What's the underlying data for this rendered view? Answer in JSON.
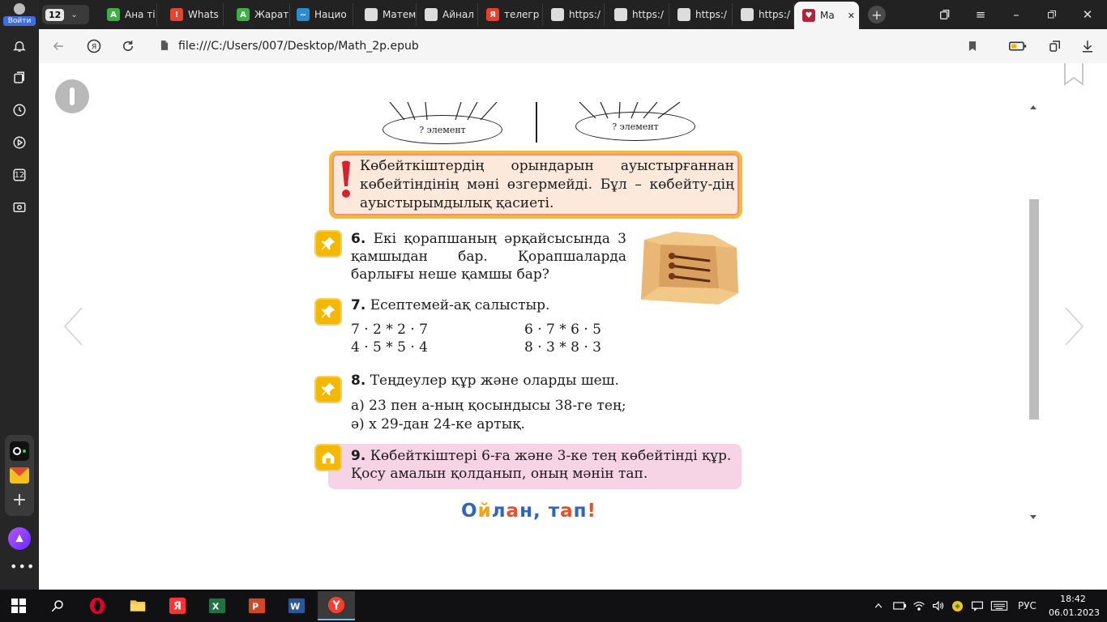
{
  "side_panel": {
    "login_label": "Войти",
    "items": [
      {
        "icon": "bell-icon"
      },
      {
        "icon": "collections-icon"
      },
      {
        "icon": "history-icon"
      },
      {
        "icon": "play-icon"
      },
      {
        "icon": "tab-counter-icon",
        "label": "12"
      },
      {
        "icon": "screenshot-icon"
      }
    ],
    "bottom": [
      {
        "icon": "alice-icon"
      },
      {
        "icon": "more-icon"
      }
    ]
  },
  "tabs": {
    "count": "12",
    "items": [
      {
        "label": "Ана ті",
        "favicon_color": "#3cb043",
        "favicon_glyph": "A"
      },
      {
        "label": "Whats",
        "favicon_color": "#e8432d",
        "favicon_glyph": "!"
      },
      {
        "label": "Жарат",
        "favicon_color": "#3cb043",
        "favicon_glyph": "A"
      },
      {
        "label": "Нацио",
        "favicon_color": "#2a8dd4",
        "favicon_glyph": "~"
      },
      {
        "label": "Матем",
        "favicon_color": "#dddddd",
        "favicon_glyph": ""
      },
      {
        "label": "Айнал",
        "favicon_color": "#dddddd",
        "favicon_glyph": ""
      },
      {
        "label": "телегр",
        "favicon_color": "#f23b2b",
        "favicon_glyph": "Я"
      },
      {
        "label": "https:/",
        "favicon_color": "#dddddd",
        "favicon_glyph": ""
      },
      {
        "label": "https:/",
        "favicon_color": "#dddddd",
        "favicon_glyph": ""
      },
      {
        "label": "https:/",
        "favicon_color": "#dddddd",
        "favicon_glyph": ""
      },
      {
        "label": "https:/",
        "favicon_color": "#dddddd",
        "favicon_glyph": ""
      },
      {
        "label": "Ma",
        "favicon_color": "#b3233a",
        "favicon_glyph": "♥",
        "active": true
      }
    ]
  },
  "address_bar": {
    "url": "file:///C:/Users/007/Desktop/Math_2p.epub"
  },
  "page": {
    "ellipse_left": "? элемент",
    "ellipse_right": "? элемент",
    "rule_text": "Көбейткіштердің орындарын ауыстырғаннан көбейтіндінің мәні өзгермейді. Бұл – көбейту-дің ауыстырымдылық қасиеті.",
    "task6": {
      "number": "6.",
      "text": "Екі қорапшаның әрқайсысында 3 қамшыдан бар. Қорапшаларда барлығы неше қамшы бар?"
    },
    "task7": {
      "number": "7.",
      "text": "Есептемей-ақ салыстыр.",
      "exprs": [
        "7 · 2 * 2 · 7",
        "4 · 5 * 5 · 4",
        "6 · 7 * 6 · 5",
        "8 · 3 * 8 · 3"
      ]
    },
    "task8": {
      "number": "8.",
      "text": "Теңдеулер құр және оларды шеш.",
      "a": "а) 23 пен а-ның қосындысы 38-ге тең;",
      "b": "ә) х 29-дан 24-ке артық."
    },
    "task9": {
      "number": "9.",
      "text": "Көбейткіштері 6-ға және 3-ке тең көбейтінді құр. Қосу амалын қолданып, оның мәнін тап."
    },
    "think_title": "Ойлан, тап!"
  },
  "taskbar": {
    "apps": [
      {
        "icon": "start-icon"
      },
      {
        "icon": "search-icon"
      },
      {
        "icon": "opera-icon"
      },
      {
        "icon": "file-explorer-icon"
      },
      {
        "icon": "yandex-icon"
      },
      {
        "icon": "excel-icon"
      },
      {
        "icon": "powerpoint-icon"
      },
      {
        "icon": "word-icon"
      },
      {
        "icon": "yandex-browser-icon",
        "active": true
      }
    ],
    "language": "РУС",
    "time": "18:42",
    "date": "06.01.2023"
  },
  "colors": {
    "rule_border": "#f5b93a",
    "rule_bg": "#fde8dc",
    "task_icon": "#f5b800",
    "task9_bg": "#f7d3e6",
    "accent_blue": "#3d6de0"
  }
}
